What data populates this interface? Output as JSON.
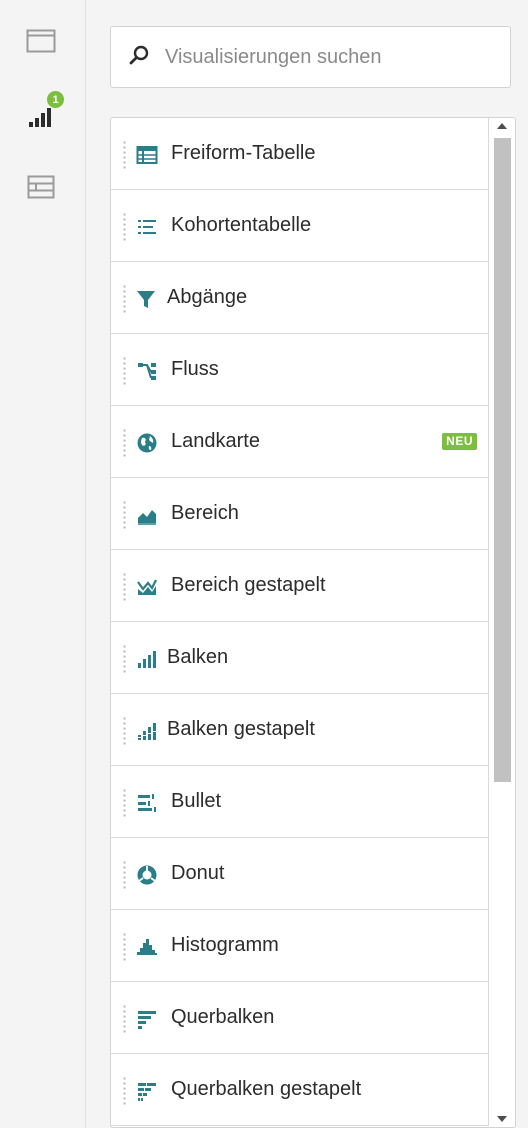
{
  "rail": {
    "items": [
      {
        "name": "panel-icon",
        "active": false
      },
      {
        "name": "visualizations-icon",
        "active": true,
        "badge": "1"
      },
      {
        "name": "components-icon",
        "active": false
      }
    ]
  },
  "search": {
    "placeholder": "Visualisierungen suchen",
    "value": ""
  },
  "visualizations": [
    {
      "label": "Freiform-Tabelle",
      "icon": "freeform-table-icon"
    },
    {
      "label": "Kohortentabelle",
      "icon": "cohort-table-icon"
    },
    {
      "label": "Abgänge",
      "icon": "fallout-funnel-icon"
    },
    {
      "label": "Fluss",
      "icon": "flow-icon"
    },
    {
      "label": "Landkarte",
      "icon": "globe-icon",
      "badge": "NEU"
    },
    {
      "label": "Bereich",
      "icon": "area-chart-icon"
    },
    {
      "label": "Bereich gestapelt",
      "icon": "area-stacked-icon"
    },
    {
      "label": "Balken",
      "icon": "bar-chart-icon"
    },
    {
      "label": "Balken gestapelt",
      "icon": "bar-stacked-icon"
    },
    {
      "label": "Bullet",
      "icon": "bullet-icon"
    },
    {
      "label": "Donut",
      "icon": "donut-icon"
    },
    {
      "label": "Histogramm",
      "icon": "histogram-icon"
    },
    {
      "label": "Querbalken",
      "icon": "horizontal-bar-icon"
    },
    {
      "label": "Querbalken gestapelt",
      "icon": "horizontal-bar-stacked-icon"
    }
  ],
  "colors": {
    "icon_teal": "#2b7d8a",
    "badge_green": "#7bbf3d",
    "rail_icon_gray": "#9a9a9a"
  }
}
